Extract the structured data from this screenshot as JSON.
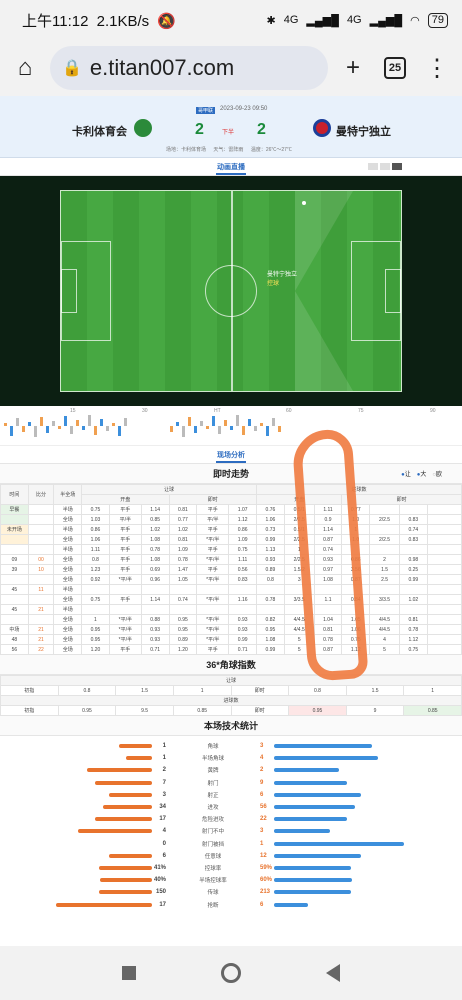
{
  "status": {
    "time": "上午11:12",
    "speed": "2.1KB/s",
    "signal1": "4G",
    "signal2": "4G",
    "battery": "79"
  },
  "browser": {
    "url": "e.titan007.com",
    "tabs": "25"
  },
  "match": {
    "tag": "哥甲联",
    "date": "2023-09-23 09:50",
    "home": "卡利体育会",
    "away": "曼特宁独立",
    "home_score": "2",
    "away_score": "2",
    "half": "下半",
    "venue": "场地：卡利体育场",
    "weather": "天气：雷阵雨",
    "temp": "温度：26℃～27℃"
  },
  "live": {
    "title": "动画直播",
    "event1": "曼特宁独立 ",
    "event2": "控球"
  },
  "timeline": [
    "15",
    "30",
    "HT",
    "60",
    "75",
    "90"
  ],
  "analysis": {
    "title": "现场分析",
    "trend": "即时走势",
    "legend": [
      "让",
      "大",
      "欧"
    ]
  },
  "table": {
    "head1": [
      "时间",
      "比分",
      "半全场",
      "让球",
      "进球数"
    ],
    "head2": [
      "开盘",
      "即时",
      "开盘",
      "即时"
    ],
    "rows": [
      [
        "早餐",
        "",
        "半场",
        "0.75",
        "平手",
        "1.14",
        "0.81",
        "平手",
        "1.07",
        "0.76",
        "0.5/1",
        "1.11",
        "0.77",
        "",
        "",
        ""
      ],
      [
        "",
        "",
        "全场",
        "1.03",
        "平/半",
        "0.85",
        "0.77",
        "平/半",
        "1.12",
        "1.06",
        "2/2.5",
        "0.9",
        "1.0",
        "2/2.5",
        "0.83",
        ""
      ],
      [
        "未开场",
        "",
        "半场",
        "0.86",
        "平手",
        "1.02",
        "1.02",
        "平手",
        "0.86",
        "0.73",
        "0.5/1",
        "1.14",
        "1",
        "",
        "0.74",
        ""
      ],
      [
        "",
        "",
        "全场",
        "1.06",
        "平手",
        "1.08",
        "0.81",
        "*平/半",
        "1.09",
        "0.99",
        "2/2.5",
        "0.87",
        "1.0",
        "2/2.5",
        "0.83",
        ""
      ],
      [
        "",
        "",
        "半场",
        "1.11",
        "平手",
        "0.78",
        "1.09",
        "平手",
        "0.75",
        "1.13",
        "1",
        "0.74",
        "",
        "",
        "",
        ""
      ],
      [
        "09",
        "00",
        "全场",
        "0.8",
        "平手",
        "1.08",
        "0.78",
        "*平/半",
        "1.11",
        "0.93",
        "2/2.5",
        "0.93",
        "0.86",
        "2",
        "0.98",
        ""
      ],
      [
        "39",
        "10",
        "全场",
        "1.23",
        "平手",
        "0.69",
        "1.47",
        "平手",
        "0.56",
        "0.89",
        "1.5/2",
        "0.97",
        "3.56",
        "1.5",
        "0.25",
        ""
      ],
      [
        "",
        "",
        "全场",
        "0.92",
        "*平/半",
        "0.96",
        "1.05",
        "*平/半",
        "0.83",
        "0.8",
        "3",
        "1.08",
        "0.87",
        "2.5",
        "0.99",
        ""
      ],
      [
        "45",
        "11",
        "半场",
        "",
        "",
        "",
        "",
        "",
        "",
        "",
        "",
        "",
        "",
        "",
        "",
        ""
      ],
      [
        "",
        "",
        "全场",
        "0.75",
        "平手",
        "1.14",
        "0.74",
        "*平/半",
        "1.16",
        "0.78",
        "3/3.5",
        "1.1",
        "0.84",
        "3/3.5",
        "1.02",
        ""
      ],
      [
        "45",
        "21",
        "半场",
        "",
        "",
        "",
        "",
        "",
        "",
        "",
        "",
        "",
        "",
        "",
        "",
        ""
      ],
      [
        "",
        "",
        "全场",
        "1",
        "*平/半",
        "0.88",
        "0.95",
        "*平/半",
        "0.93",
        "0.82",
        "4/4.5",
        "1.04",
        "1.05",
        "4/4.5",
        "0.81",
        ""
      ],
      [
        "中场",
        "21",
        "全场",
        "0.95",
        "*平/半",
        "0.93",
        "0.95",
        "*平/半",
        "0.93",
        "0.95",
        "4/4.5",
        "0.81",
        "1.06",
        "4/4.5",
        "0.78",
        ""
      ],
      [
        "48",
        "21",
        "全场",
        "0.95",
        "*平/半",
        "0.93",
        "0.89",
        "*平/半",
        "0.99",
        "1.08",
        "5",
        "0.78",
        "0.75",
        "4",
        "1.12",
        ""
      ],
      [
        "56",
        "22",
        "全场",
        "1.20",
        "平手",
        "0.71",
        "1.20",
        "平手",
        "0.71",
        "0.99",
        "5",
        "0.87",
        "1.12",
        "5",
        "0.75",
        ""
      ]
    ]
  },
  "corners": {
    "title": "36*角球指数",
    "sub1": "让球",
    "sub2": "进球数",
    "row1": [
      "初指",
      "0.8",
      "1.5",
      "1",
      "即时",
      "0.8",
      "1.5",
      "1"
    ],
    "row2": [
      "初指",
      "0.95",
      "9.5",
      "0.85",
      "即时",
      "0.95",
      "9",
      "0.85"
    ]
  },
  "stats": {
    "title": "本场技术统计",
    "rows": [
      {
        "label": "角球",
        "home": "1",
        "away": "3"
      },
      {
        "label": "半场角球",
        "home": "1",
        "away": "4"
      },
      {
        "label": "黄牌",
        "home": "2",
        "away": "2"
      },
      {
        "label": "射门",
        "home": "7",
        "away": "9"
      },
      {
        "label": "射正",
        "home": "3",
        "away": "6"
      },
      {
        "label": "进攻",
        "home": "34",
        "away": "56"
      },
      {
        "label": "危险进攻",
        "home": "17",
        "away": "22"
      },
      {
        "label": "射门不中",
        "home": "4",
        "away": "3"
      },
      {
        "label": "射门被挡",
        "home": "0",
        "away": "1"
      },
      {
        "label": "任意球",
        "home": "6",
        "away": "12"
      },
      {
        "label": "控球率",
        "home": "41%",
        "away": "59%"
      },
      {
        "label": "半场控球率",
        "home": "40%",
        "away": "60%"
      },
      {
        "label": "传球",
        "home": "150",
        "away": "213"
      },
      {
        "label": "抢断",
        "home": "17",
        "away": "6"
      }
    ],
    "home_frac": [
      0.25,
      0.2,
      0.5,
      0.44,
      0.33,
      0.38,
      0.44,
      0.57,
      0.0,
      0.33,
      0.41,
      0.4,
      0.41,
      0.74
    ],
    "away_frac": [
      0.75,
      0.8,
      0.5,
      0.56,
      0.67,
      0.62,
      0.56,
      0.43,
      1.0,
      0.67,
      0.59,
      0.6,
      0.59,
      0.26
    ]
  },
  "colors": {
    "home": "#e8732d",
    "away": "#3c8fdc",
    "accent": "#2d6cc0",
    "annotation": "#f07a3f"
  }
}
